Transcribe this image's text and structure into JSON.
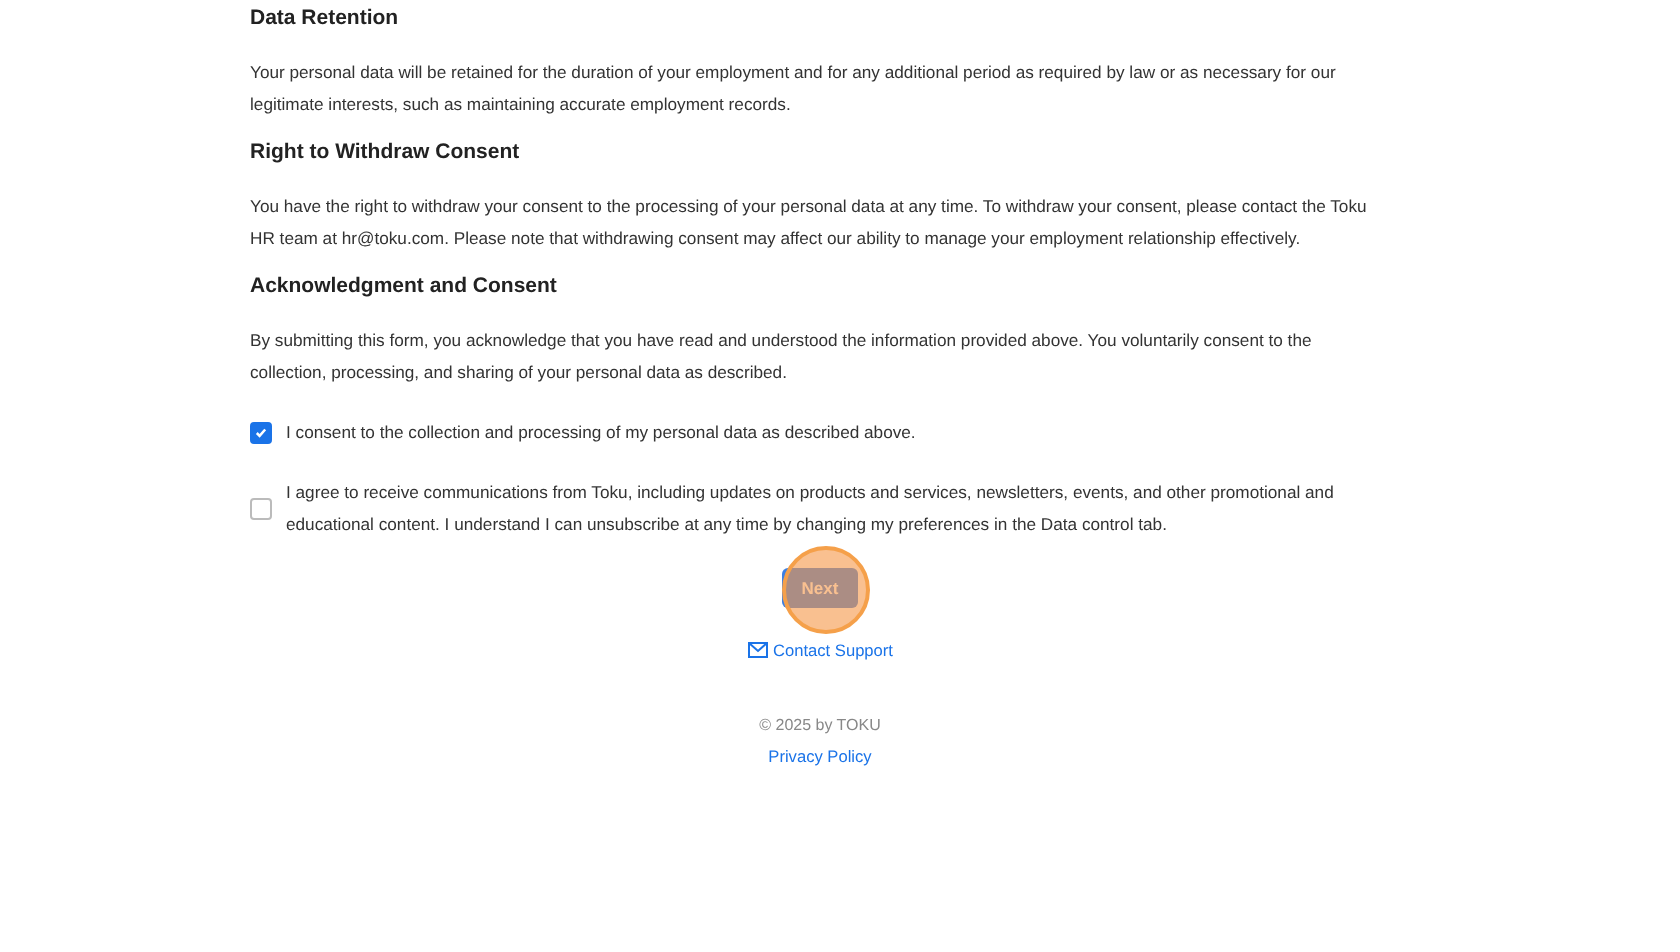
{
  "sections": [
    {
      "heading": "Data Retention",
      "text": "Your personal data will be retained for the duration of your employment and for any additional period as required by law or as necessary for our legitimate interests, such as maintaining accurate employment records."
    },
    {
      "heading": "Right to Withdraw Consent",
      "text": "You have the right to withdraw your consent to the processing of your personal data at any time. To withdraw your consent, please contact the Toku HR team at hr@toku.com. Please note that withdrawing consent may affect our ability to manage your employment relationship effectively."
    },
    {
      "heading": "Acknowledgment and Consent",
      "text": "By submitting this form, you acknowledge that you have read and understood the information provided above. You voluntarily consent to the collection, processing, and sharing of your personal data as described."
    }
  ],
  "consents": [
    {
      "label": "I consent to the collection and processing of my personal data as described above.",
      "checked": true
    },
    {
      "label": "I agree to receive communications from Toku, including updates on products and services, newsletters, events, and other promotional and educational content. I understand I can unsubscribe at any time by changing my preferences in the Data control tab.",
      "checked": false
    }
  ],
  "next_button": {
    "label": "Next",
    "click_highlight": true
  },
  "contact_link": "Contact Support",
  "footer": {
    "copyright": "© 2025 by TOKU",
    "privacy_link": "Privacy Policy"
  }
}
